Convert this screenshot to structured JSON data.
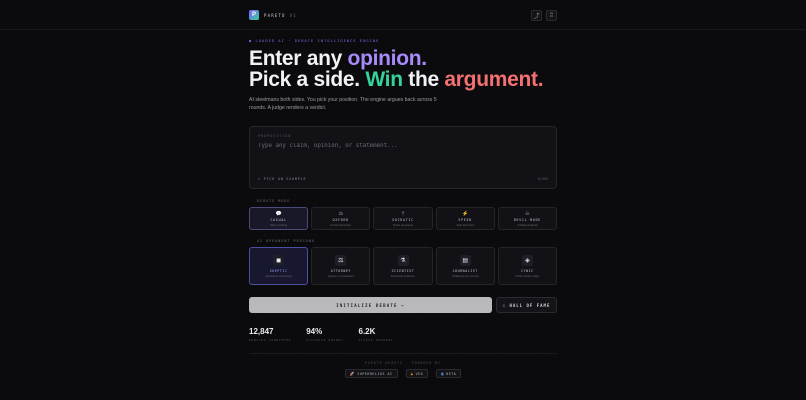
{
  "header": {
    "brand": "PARETO",
    "version": "V1",
    "logo_glyph": "P",
    "actions": [
      {
        "name": "link-icon",
        "glyph": "⤴"
      },
      {
        "name": "trophy-icon",
        "glyph": "♖"
      }
    ]
  },
  "hero": {
    "eyebrow": "● LOADED AI · DEBATE INTELLIGENCE ENGINE",
    "line1_a": "Enter any ",
    "line1_b": "opinion.",
    "line2_a": "Pick a side. ",
    "line2_b": "Win",
    "line2_c": " the ",
    "line2_d": "argument.",
    "subtitle": "AI steelmans both sides. You pick your position. The engine argues back across 5 rounds. A judge renders a verdict."
  },
  "input": {
    "label": "PROPOSITION",
    "placeholder": "Type any claim, opinion, or statement...",
    "value": "",
    "pick_label": "✎ PICK AN EXAMPLE",
    "counter": "0/500"
  },
  "debate_mode": {
    "label": "DEBATE MODE",
    "options": [
      {
        "icon": "💬",
        "name": "CASUAL",
        "desc": "Start soothing",
        "active": true
      },
      {
        "icon": "⚖",
        "name": "OXFORD",
        "desc": "Formal structure",
        "active": false
      },
      {
        "icon": "†",
        "name": "SOCRATIC",
        "desc": "Probe questions",
        "active": false
      },
      {
        "icon": "⚡",
        "name": "SPEED",
        "desc": "Fast and brief",
        "active": false
      },
      {
        "icon": "☠",
        "name": "DEVIL MODE",
        "desc": "Unfiltered attack",
        "active": false
      }
    ]
  },
  "persona": {
    "label": "AI OPPONENT PERSONA",
    "options": [
      {
        "icon": "◼",
        "name": "SKEPTIC",
        "desc": "Questions everything",
        "active": true
      },
      {
        "icon": "⚖",
        "name": "ATTORNEY",
        "desc": "Argues on precedent",
        "active": false
      },
      {
        "icon": "⚗",
        "name": "SCIENTIST",
        "desc": "Demands evidence",
        "active": false
      },
      {
        "icon": "▤",
        "name": "JOURNALIST",
        "desc": "Challenges by source",
        "active": false
      },
      {
        "icon": "◈",
        "name": "CYNIC",
        "desc": "Finds hidden angle",
        "active": false
      }
    ]
  },
  "actions": {
    "primary": "INITIALIZE DEBATE  →",
    "secondary": "♖ HALL OF FAME"
  },
  "stats": [
    {
      "value": "12,847",
      "label": "DEBATES COMPLETED"
    },
    {
      "value": "94%",
      "label": "ACCURATE ROUNDS"
    },
    {
      "value": "6.2K",
      "label": "ACTIVE ARGUERS"
    }
  ],
  "footer": {
    "text": "PARETO DEBATE · POWERED BY",
    "badges": [
      {
        "icon": "🚀",
        "label": "SUPERHELIOS AI"
      },
      {
        "icon": "▲",
        "label": "VEO"
      },
      {
        "icon": "▣",
        "label": "BETA"
      }
    ]
  },
  "colors": {
    "accent_purple": "#a78bfa",
    "accent_green": "#34d399",
    "accent_red": "#f47171",
    "background": "#0b0b0e"
  }
}
